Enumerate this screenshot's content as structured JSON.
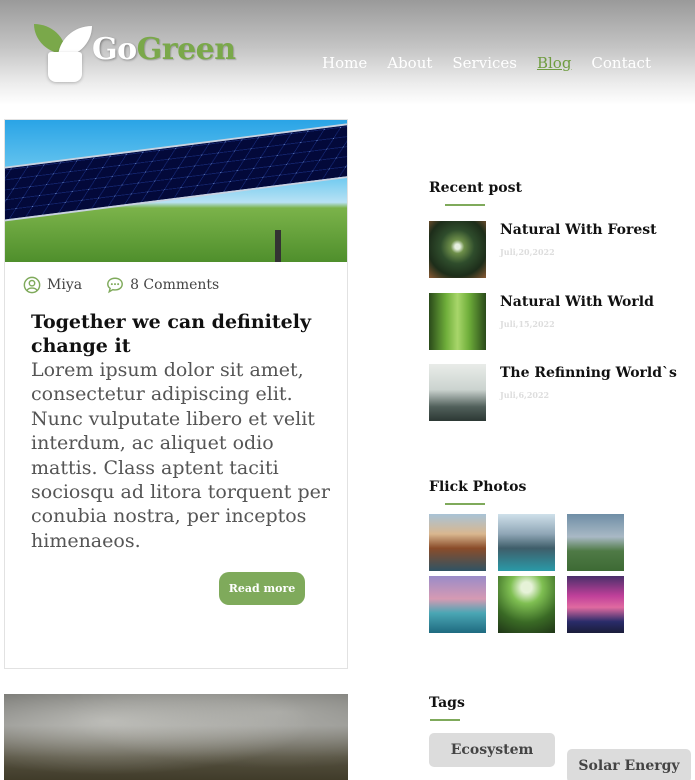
{
  "brand": {
    "name_part1": "Go",
    "name_part2": "Green"
  },
  "nav": {
    "items": [
      "Home",
      "About",
      "Services",
      "Blog",
      "Contact"
    ],
    "active": "Blog",
    "active_color": "#6f9c40"
  },
  "post": {
    "author": "Miya",
    "comments": "8 Comments",
    "title": "Together we can definitely change it",
    "body": "Lorem ipsum dolor sit amet, consectetur adipiscing elit. Nunc vulputate libero et velit interdum, ac aliquet odio mattis. Class aptent taciti sociosqu ad litora torquent per conubia nostra, per inceptos himenaeos.",
    "read_more": "Read more",
    "image_icon": "solar-panel-photo"
  },
  "second_post": {
    "image_icon": "foggy-forest-photo"
  },
  "sidebar": {
    "recent_heading": "Recent post",
    "recent": [
      {
        "title": "Natural With Forest",
        "date": "Juli,20,2022"
      },
      {
        "title": "Natural With World",
        "date": "Juli,15,2022"
      },
      {
        "title": "The Refinning World`s",
        "date": "Juli,6,2022"
      }
    ],
    "flick_heading": "Flick Photos",
    "tags_heading": "Tags",
    "tags": [
      "Ecosystem",
      "Solar Energy"
    ]
  },
  "colors": {
    "accent": "#7faa5b",
    "tag_bg": "#dcdcdc"
  }
}
